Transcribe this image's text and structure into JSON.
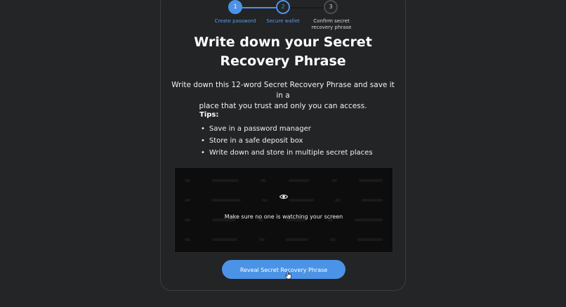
{
  "stepper": {
    "steps": [
      {
        "number": "1",
        "label": "Create password"
      },
      {
        "number": "2",
        "label": "Secure wallet"
      },
      {
        "number": "3",
        "label_line1": "Confirm secret",
        "label_line2": "recovery phrase"
      }
    ]
  },
  "main": {
    "title_line1": "Write down your Secret",
    "title_line2": "Recovery Phrase",
    "description_line1": "Write down this 12-word Secret Recovery Phrase and save it in a",
    "description_line2": "place that you trust and only you can access.",
    "tips_title": "Tips:",
    "tips": [
      "Save in a password manager",
      "Store in a safe deposit box",
      "Write down and store in multiple secret places"
    ]
  },
  "phrase_box": {
    "icon": "eye-icon",
    "warning": "Make sure no one is watching your screen"
  },
  "actions": {
    "reveal_label": "Reveal Secret Recovery Phrase"
  },
  "colors": {
    "accent": "#4b93e6",
    "background": "#242526"
  }
}
